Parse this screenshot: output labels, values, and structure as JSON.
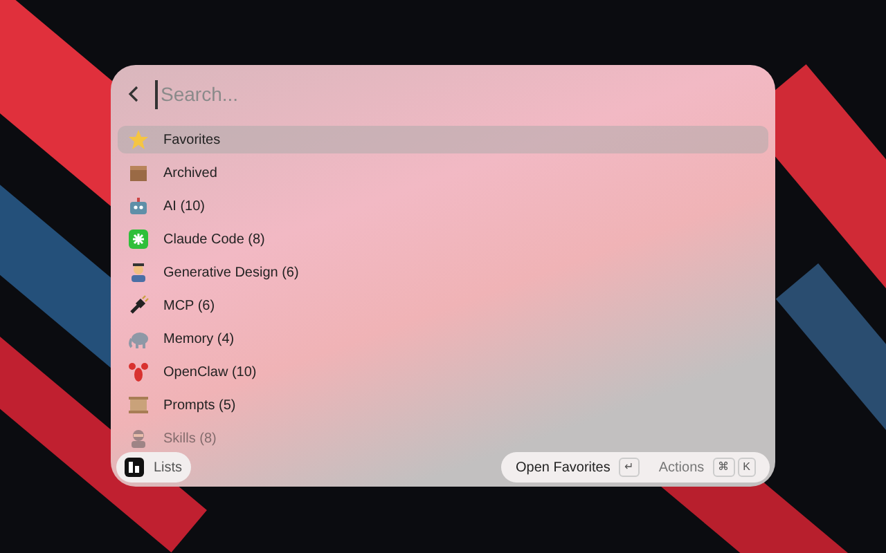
{
  "search": {
    "placeholder": "Search..."
  },
  "items": [
    {
      "label": "Favorites",
      "selected": true
    },
    {
      "label": "Archived",
      "selected": false
    },
    {
      "label": "AI (10)",
      "selected": false
    },
    {
      "label": "Claude Code (8)",
      "selected": false
    },
    {
      "label": "Generative Design (6)",
      "selected": false
    },
    {
      "label": "MCP (6)",
      "selected": false
    },
    {
      "label": "Memory (4)",
      "selected": false
    },
    {
      "label": "OpenClaw (10)",
      "selected": false
    },
    {
      "label": "Prompts (5)",
      "selected": false
    },
    {
      "label": "Skills (8)",
      "selected": false
    }
  ],
  "footer": {
    "left_label": "Lists",
    "primary_action": "Open Favorites",
    "primary_key": "↵",
    "actions_label": "Actions",
    "action_keys": [
      "⌘",
      "K"
    ]
  }
}
